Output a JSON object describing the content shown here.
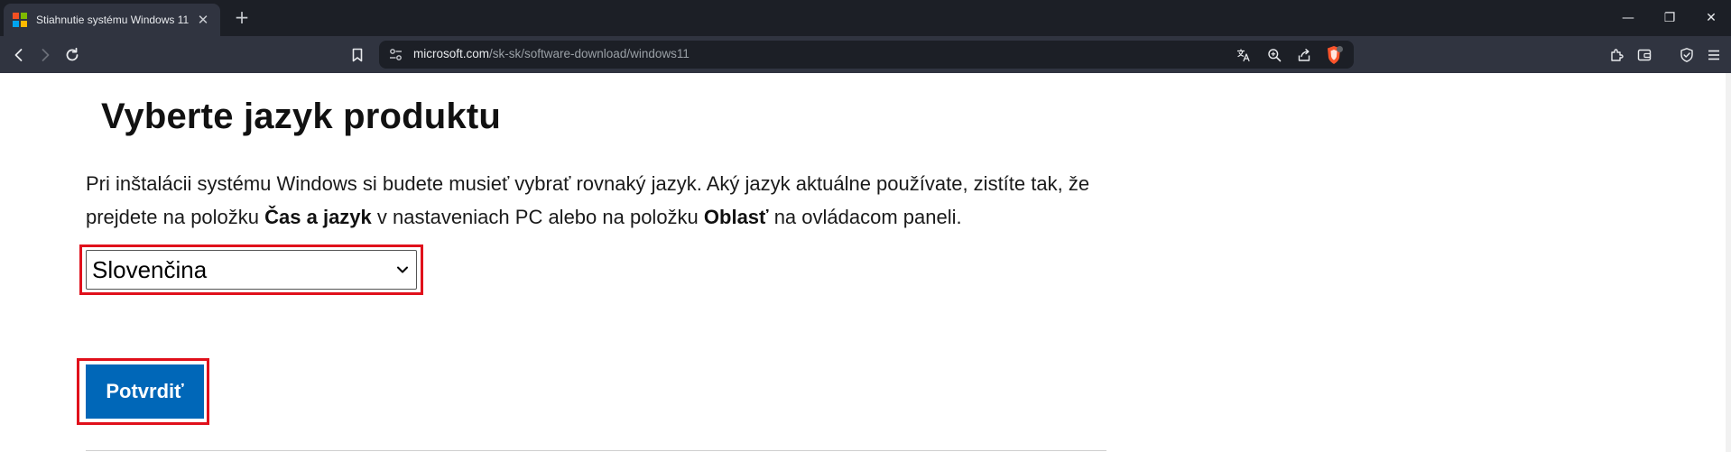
{
  "tab": {
    "title": "Stiahnutie systému Windows 11"
  },
  "window": {
    "minimize": "—",
    "maximize": "❐",
    "close": "✕"
  },
  "toolbar": {
    "url_host": "microsoft.com",
    "url_path": "/sk-sk/software-download/windows11"
  },
  "page": {
    "heading": "Vyberte jazyk produktu",
    "desc_part1": "Pri inštalácii systému Windows si budete musieť vybrať rovnaký jazyk. Aký jazyk aktuálne používate, zistíte tak, že prejdete na položku ",
    "desc_bold1": "Čas a jazyk",
    "desc_part2": " v nastaveniach PC alebo na položku ",
    "desc_bold2": "Oblasť",
    "desc_part3": " na ovládacom paneli.",
    "language_selected": "Slovenčina",
    "confirm_label": "Potvrdiť"
  },
  "colors": {
    "confirm_bg": "#0067b8",
    "highlight": "#e0101b",
    "tab_strip": "#1c1f26",
    "toolbar": "#303440"
  }
}
